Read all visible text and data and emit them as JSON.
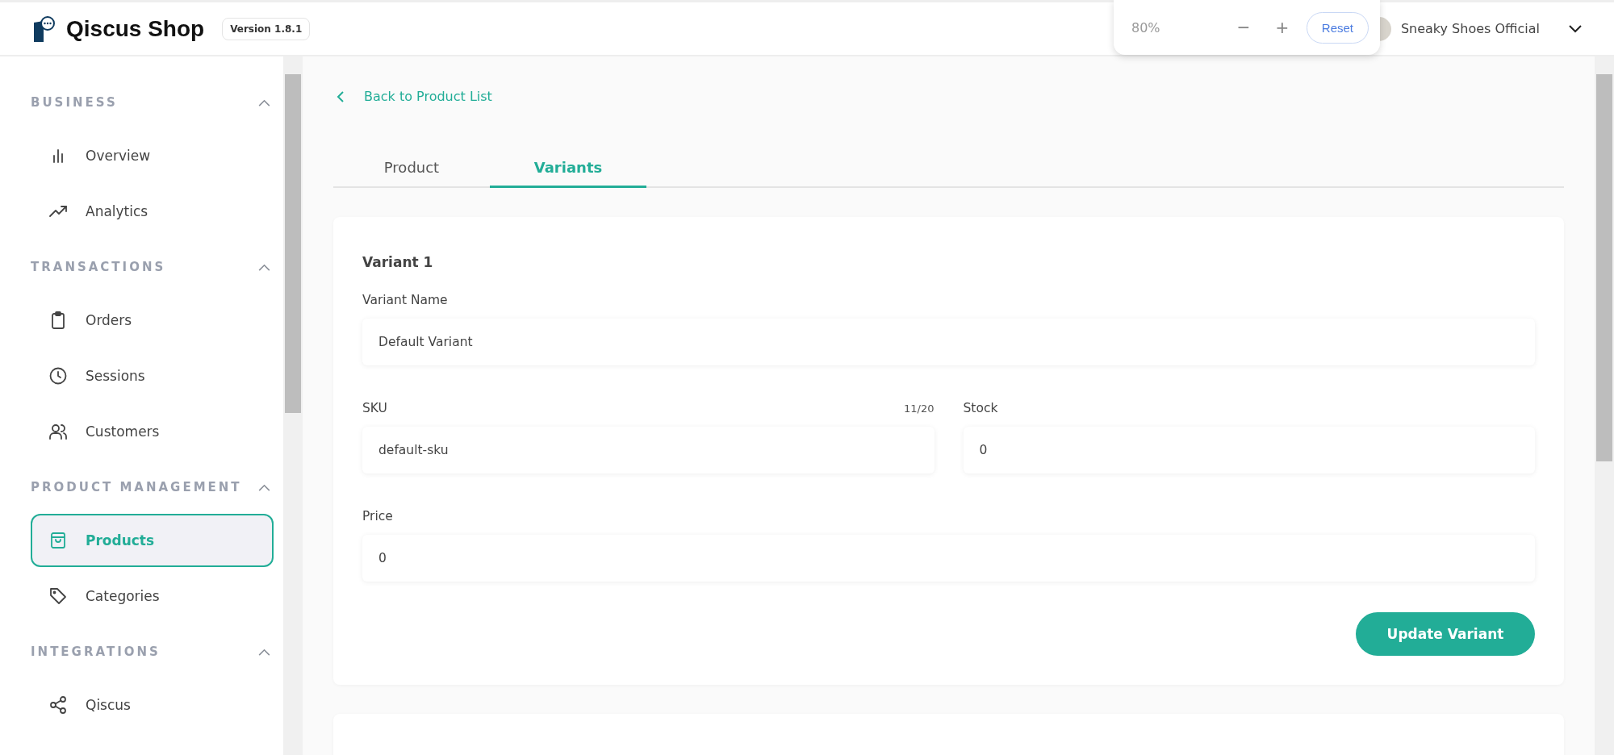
{
  "header": {
    "app_name": "Qiscus Shop",
    "version": "Version 1.8.1",
    "store_name": "Sneaky Shoes Official"
  },
  "zoom_popup": {
    "zoom": "80%",
    "minus": "−",
    "plus": "+",
    "reset": "Reset"
  },
  "sidebar": {
    "sections": [
      {
        "title": "BUSINESS",
        "expanded": true,
        "items": [
          {
            "label": "Overview",
            "kind": "bars",
            "selected": false
          },
          {
            "label": "Analytics",
            "kind": "trend",
            "selected": false
          }
        ]
      },
      {
        "title": "TRANSACTIONS",
        "expanded": true,
        "items": [
          {
            "label": "Orders",
            "kind": "clipboard",
            "selected": false
          },
          {
            "label": "Sessions",
            "kind": "clock",
            "selected": false
          },
          {
            "label": "Customers",
            "kind": "users",
            "selected": false
          }
        ]
      },
      {
        "title": "PRODUCT MANAGEMENT",
        "expanded": true,
        "items": [
          {
            "label": "Products",
            "kind": "bag",
            "selected": true
          },
          {
            "label": "Categories",
            "kind": "tag",
            "selected": false
          }
        ]
      },
      {
        "title": "INTEGRATIONS",
        "expanded": true,
        "items": [
          {
            "label": "Qiscus",
            "kind": "share",
            "selected": false
          }
        ]
      }
    ]
  },
  "back_link": "Back to Product List",
  "tabs": [
    {
      "label": "Product",
      "selected": false
    },
    {
      "label": "Variants",
      "selected": true
    }
  ],
  "variant_card": {
    "title": "Variant 1",
    "variant_name": {
      "label": "Variant Name",
      "value": "Default Variant"
    },
    "sku": {
      "label": "SKU",
      "counter": "11/20",
      "value": "default-sku"
    },
    "stock": {
      "label": "Stock",
      "value": "0"
    },
    "price": {
      "label": "Price",
      "value": "0"
    },
    "button": "Update Variant"
  }
}
